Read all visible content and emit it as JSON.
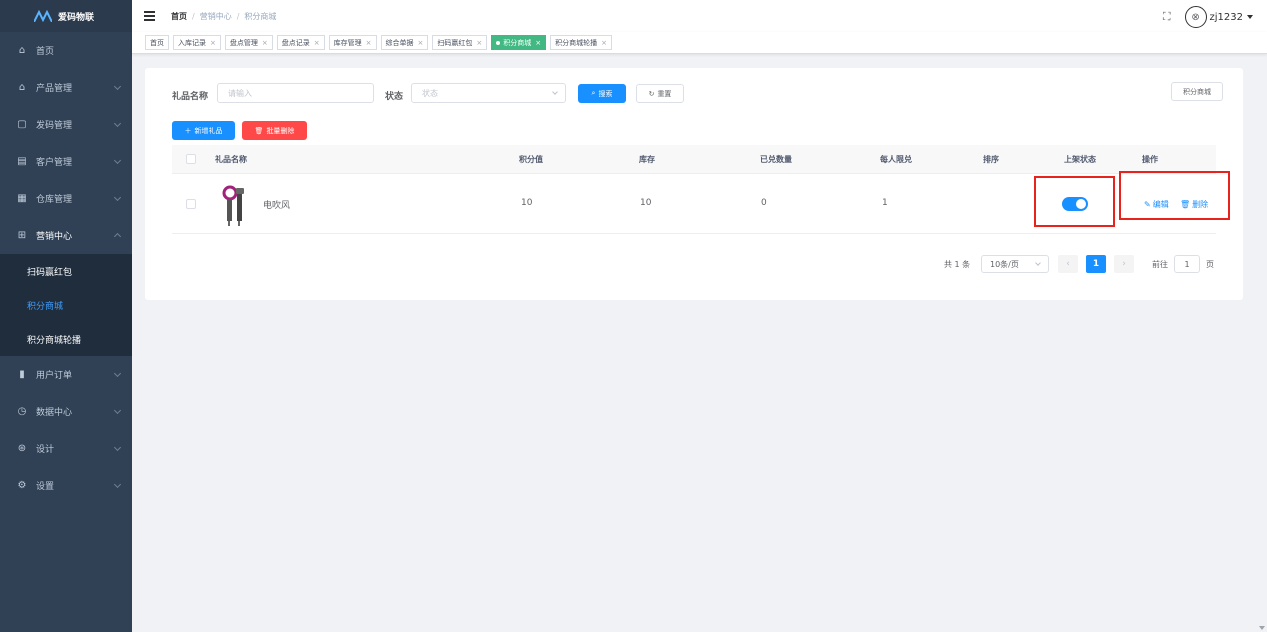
{
  "brand": {
    "title": "爱码物联"
  },
  "sidebar": {
    "items": [
      {
        "label": "首页",
        "icon": "home-icon"
      },
      {
        "label": "产品管理",
        "icon": "product-icon"
      },
      {
        "label": "发码管理",
        "icon": "code-icon"
      },
      {
        "label": "客户管理",
        "icon": "customer-icon"
      },
      {
        "label": "仓库管理",
        "icon": "warehouse-icon"
      },
      {
        "label": "营销中心",
        "icon": "marketing-icon"
      },
      {
        "label": "用户订单",
        "icon": "order-icon"
      },
      {
        "label": "数据中心",
        "icon": "data-icon"
      },
      {
        "label": "设计",
        "icon": "design-icon"
      },
      {
        "label": "设置",
        "icon": "settings-icon"
      }
    ],
    "marketing_sub": [
      "扫码赢红包",
      "积分商城",
      "积分商城轮播"
    ]
  },
  "header": {
    "breadcrumb": [
      "首页",
      "营销中心",
      "积分商城"
    ],
    "breadcrumb_sep": "/",
    "username": "zj1232"
  },
  "tags": [
    "首页",
    "入库记录",
    "盘点管理",
    "盘点记录",
    "库存管理",
    "综合单据",
    "扫码赢红包",
    "积分商城",
    "积分商城轮播"
  ],
  "tag_close": "×",
  "search": {
    "name_label": "礼品名称",
    "name_placeholder": "请输入",
    "status_label": "状态",
    "status_placeholder": "状态",
    "search_btn": "搜索",
    "reset_btn": "重置",
    "mall_btn": "积分商城"
  },
  "actions": {
    "add_btn": "新增礼品",
    "batch_delete_btn": "批量删除"
  },
  "table": {
    "columns": [
      "礼品名称",
      "积分值",
      "库存",
      "已兑数量",
      "每人限兑",
      "排序",
      "上架状态",
      "操作"
    ],
    "rows": [
      {
        "name": "电吹风",
        "points": "10",
        "stock": "10",
        "redeemed": "0",
        "limit": "1",
        "sort": "",
        "on_shelf": true,
        "edit": "编辑",
        "delete": "删除"
      }
    ]
  },
  "pagination": {
    "total_text": "共 1 条",
    "page_size": "10条/页",
    "current_page": "1",
    "goto_label": "前往",
    "goto_value": "1",
    "page_suffix": "页"
  },
  "colors": {
    "primary": "#1890ff",
    "danger": "#ff4949",
    "sidebar_bg": "#304156",
    "tag_active": "#42b983",
    "highlight_box": "#e8221c"
  }
}
